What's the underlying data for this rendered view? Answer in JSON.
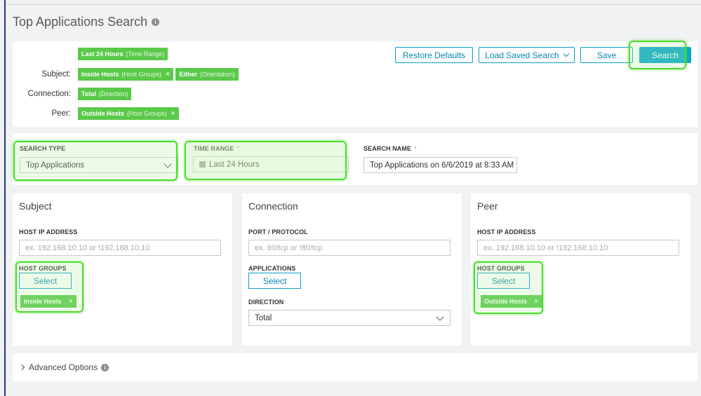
{
  "page": {
    "title": "Top Applications Search",
    "title_info": "i"
  },
  "summary": {
    "time_chip": {
      "value": "Last 24 Hours",
      "kind": "(Time Range)"
    },
    "subject_label": "Subject:",
    "subject_chips": [
      {
        "value": "Inside Hosts",
        "kind": "(Host Groups)",
        "removable": true
      },
      {
        "value": "Either",
        "kind": "(Orientation)",
        "removable": false
      }
    ],
    "connection_label": "Connection:",
    "connection_chip": {
      "value": "Total",
      "kind": "(Direction)"
    },
    "peer_label": "Peer:",
    "peer_chip": {
      "value": "Outside Hosts",
      "kind": "(Host Groups)"
    },
    "remove_glyph": "×"
  },
  "toolbar": {
    "restore_label": "Restore Defaults",
    "load_label": "Load Saved Search",
    "save_label": "Save",
    "search_label": "Search"
  },
  "search_settings": {
    "type_label": "SEARCH TYPE",
    "type_value": "Top Applications",
    "time_label": "TIME RANGE",
    "time_value": "Last 24 Hours",
    "name_label": "SEARCH NAME",
    "name_value": "Top Applications on 6/6/2019 at 8:33 AM",
    "required_mark": "*"
  },
  "subject": {
    "title": "Subject",
    "ip_label": "HOST IP ADDRESS",
    "ip_placeholder": "ex. 192.168.10.10 or !192.168.10.10",
    "groups_label": "HOST GROUPS",
    "select_label": "Select",
    "chip": "Inside Hosts"
  },
  "connection": {
    "title": "Connection",
    "port_label": "PORT / PROTOCOL",
    "port_placeholder": "ex. 80/tcp or !80/tcp",
    "apps_label": "APPLICATIONS",
    "select_label": "Select",
    "direction_label": "DIRECTION",
    "direction_value": "Total"
  },
  "peer": {
    "title": "Peer",
    "ip_label": "HOST IP ADDRESS",
    "ip_placeholder": "ex. 192.168.10.10 or !192.168.10.10",
    "groups_label": "HOST GROUPS",
    "select_label": "Select",
    "chip": "Outside Hosts"
  },
  "advanced": {
    "label": "Advanced Options",
    "info": "i"
  },
  "colors": {
    "chip": "#5ac94a",
    "accent": "#08a6cb",
    "highlight": "#4cdc2c"
  }
}
